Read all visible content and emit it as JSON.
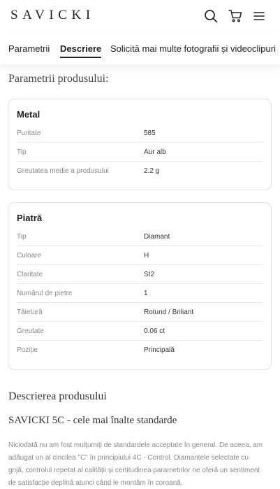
{
  "header": {
    "logo": "SAVICKI",
    "icons": [
      "search-icon",
      "cart-icon",
      "menu-icon"
    ]
  },
  "tabs": [
    {
      "label": "Parametrii",
      "active": false
    },
    {
      "label": "Descriere",
      "active": true
    },
    {
      "label": "Solicită mai multe fotografii și videoclipuri",
      "active": false
    }
  ],
  "params_title": "Parametrii produsului:",
  "metal": {
    "title": "Metal",
    "rows": [
      {
        "k": "Puritate",
        "v": "585"
      },
      {
        "k": "Tip",
        "v": "Aur alb"
      },
      {
        "k": "Greutatea medie a produsului",
        "v": "2.2 g"
      }
    ]
  },
  "stone": {
    "title": "Piatră",
    "rows": [
      {
        "k": "Tip",
        "v": "Diamant"
      },
      {
        "k": "Culoare",
        "v": "H"
      },
      {
        "k": "Claritate",
        "v": "SI2"
      },
      {
        "k": "Numărul de pietre",
        "v": "1"
      },
      {
        "k": "Tăietură",
        "v": "Rotund / Briliant"
      },
      {
        "k": "Greutate",
        "v": "0.06 ct"
      },
      {
        "k": "Poziție",
        "v": "Principală"
      }
    ]
  },
  "description": {
    "title": "Descrierea produsului",
    "subtitle": "SAVICKI 5C - cele mai înalte standarde",
    "text": "Niciodată nu am fost mulțumiți de standardele acceptate în general. De aceea, am adăugat un al cincilea \"C\" în principiului 4C - Control. Diamantele selectate cu grijă, controlul repetat al calității și certitudinea parametrilor ne oferă un sentiment de satisfacție deplină atunci când le montăm în coroană."
  }
}
